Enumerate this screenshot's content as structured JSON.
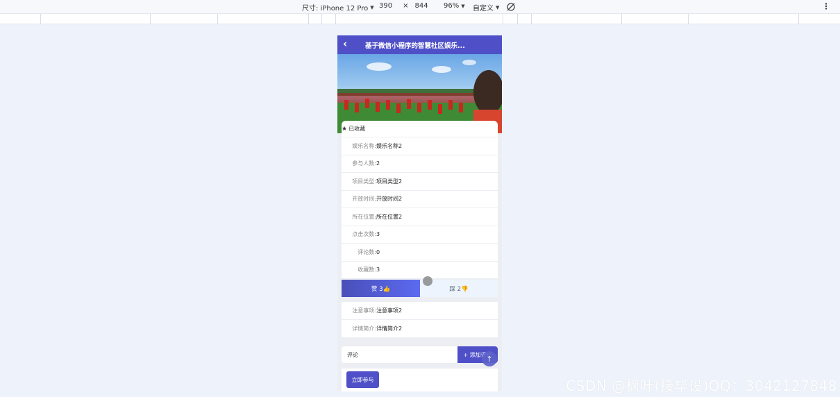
{
  "devtools": {
    "size_label": "尺寸: iPhone 12 Pro",
    "width": "390",
    "times": "×",
    "height": "844",
    "zoom": "96%",
    "throttle": "自定义",
    "more": "⋮"
  },
  "navbar": {
    "back_icon": "chevron-left-icon",
    "title": "基于微信小程序的智慧社区娱乐..."
  },
  "favorite": {
    "label": "已收藏",
    "icon": "star-icon"
  },
  "details": [
    {
      "label": "娱乐名称:",
      "value": "娱乐名称2"
    },
    {
      "label": "参与人数:",
      "value": "2"
    },
    {
      "label": "项目类型:",
      "value": "项目类型2"
    },
    {
      "label": "开放时间:",
      "value": "开放时间2"
    },
    {
      "label": "所在位置:",
      "value": "所在位置2"
    },
    {
      "label": "点击次数:",
      "value": "3"
    },
    {
      "label": "评论数:",
      "value": "0"
    },
    {
      "label": "收藏数:",
      "value": "3"
    }
  ],
  "votes": {
    "up_label": "赞 3👍",
    "down_label": "踩 2👎"
  },
  "details2": [
    {
      "label": "注意事项:",
      "value": "注意事项2"
    },
    {
      "label": "详情简介:",
      "value": "详情简介2"
    }
  ],
  "comment": {
    "placeholder": "评论",
    "add_label": "+ 添加评论"
  },
  "scrolltop_icon": "arrow-up-icon",
  "join_label": "立即参与",
  "watermark": "CSDN @枫叶(接毕设)QQ：3042127848"
}
